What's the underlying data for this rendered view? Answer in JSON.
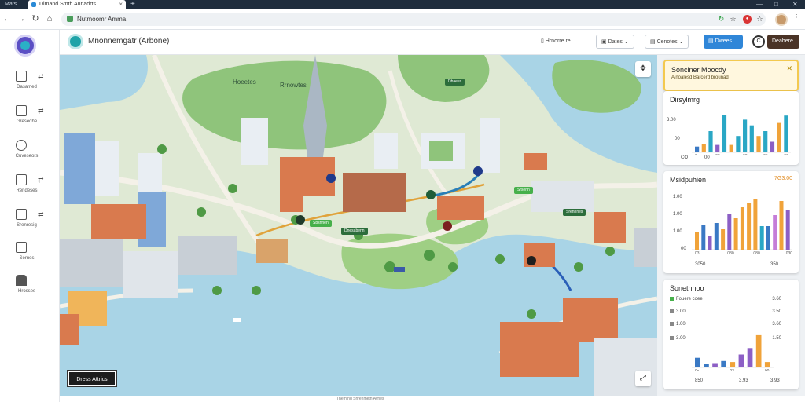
{
  "browser": {
    "tabs": [
      {
        "label": "Mats"
      },
      {
        "label": "Dimand Smth Aunadrts"
      }
    ],
    "url": "Nutmoomr Amma",
    "colors": {
      "chrome": "#1f2d3d",
      "accent": "#2f86d8"
    }
  },
  "sidebar": {
    "items": [
      {
        "label": "Dasamed",
        "icon": "calendar-icon"
      },
      {
        "label": "Gresedhe",
        "icon": "grid-icon"
      },
      {
        "label": "Cuveseors",
        "icon": "gauge-icon"
      },
      {
        "label": "Rendeses",
        "icon": "document-icon"
      },
      {
        "label": "Srenresig",
        "icon": "table-icon"
      },
      {
        "label": "Sernes",
        "icon": "list-icon"
      },
      {
        "label": "Hrosses",
        "icon": "people-icon"
      }
    ]
  },
  "header": {
    "title": "Mnonnemgatr  (Arbone)",
    "actions": [
      {
        "label": "Hrnorre re"
      },
      {
        "label": "Dates"
      },
      {
        "label": "Cenotes"
      },
      {
        "label": "Dwees"
      },
      {
        "label": "Deahere"
      }
    ]
  },
  "map": {
    "labels": [
      "Hoeetes",
      "Rrnowtes"
    ],
    "tags": [
      "Dnesabenn",
      "Sbsnnen",
      "Srennnes",
      "Srsenn",
      "Dhaees"
    ],
    "bottom_button": "Dress Attrics",
    "footer": "Tnemtnd Snrenmetn Avnes"
  },
  "panel": {
    "alert": {
      "title": "Sonciner Moocdy",
      "subtitle": "Alnoalesd Barcerd brounad"
    },
    "cards": [
      {
        "title": "Dirsylmrg",
        "value": "",
        "tick_labels": [
          "3.00",
          "00"
        ],
        "x_labels": [
          "0s",
          "03",
          "03",
          "05",
          "00"
        ],
        "footer_labels": [
          "CO",
          "00"
        ]
      },
      {
        "title": "Msidpuhien",
        "value": "7G3.00",
        "tick_labels": [
          "1.00",
          "1.00",
          "1.00",
          "00"
        ],
        "x_labels": [
          "03",
          "030",
          "080",
          "030"
        ],
        "footer_labels": [
          "3050",
          "350"
        ]
      },
      {
        "title": "Sonetnnoo",
        "value": "",
        "legend": [
          {
            "label": "Fouere coee",
            "value": "3.60",
            "color": "#47b04b"
          },
          {
            "label": "3 00",
            "value": "3.50",
            "color": "#888888"
          },
          {
            "label": "1.00",
            "value": "3.60",
            "color": "#888888"
          },
          {
            "label": "3.00",
            "value": "1.50",
            "color": "#888888"
          }
        ],
        "x_labels": [
          "0s",
          "03",
          "00"
        ],
        "footer_labels": [
          "850",
          "3.93",
          "3.93"
        ]
      }
    ]
  },
  "chart_data": [
    {
      "type": "bar",
      "title": "Dirsylmrg",
      "values": [
        0.7,
        1.0,
        2.6,
        0.9,
        4.6,
        0.9,
        2.0,
        4.0,
        3.3,
        2.0,
        2.6,
        1.3,
        3.6,
        4.5
      ],
      "colors": [
        "#3a79c4",
        "#f0a33a",
        "#2aa7c5",
        "#8c5fc5",
        "#2aa7c5",
        "#f0a33a",
        "#2aa7c5",
        "#2aa7c5",
        "#2aa7c5",
        "#f0a33a",
        "#2aa7c5",
        "#8c5fc5",
        "#f0a33a",
        "#2aa7c5"
      ],
      "ylim": [
        0,
        5
      ]
    },
    {
      "type": "bar",
      "title": "Msidpuhien",
      "values": [
        1.1,
        1.6,
        0.9,
        1.7,
        1.3,
        2.3,
        2.0,
        2.7,
        3.0,
        3.2,
        1.5,
        1.5,
        2.2,
        3.1,
        2.5
      ],
      "colors": [
        "#f0a33a",
        "#3a79c4",
        "#8c5fc5",
        "#3a79c4",
        "#f0a33a",
        "#8c5fc5",
        "#f0a33a",
        "#f0a33a",
        "#f0a33a",
        "#f0a33a",
        "#2aa7c5",
        "#3a79c4",
        "#c57dd8",
        "#f0a33a",
        "#8c5fc5"
      ],
      "ylim": [
        0,
        3.5
      ]
    },
    {
      "type": "bar",
      "title": "Sonetnnoo",
      "values": [
        0.9,
        0.3,
        0.4,
        0.6,
        0.5,
        1.2,
        1.8,
        3.0,
        0.5
      ],
      "colors": [
        "#3a79c4",
        "#3a79c4",
        "#8c5fc5",
        "#3a79c4",
        "#f0a33a",
        "#8c5fc5",
        "#8c5fc5",
        "#f0a33a",
        "#f0a33a"
      ],
      "ylim": [
        0,
        3.5
      ]
    }
  ]
}
